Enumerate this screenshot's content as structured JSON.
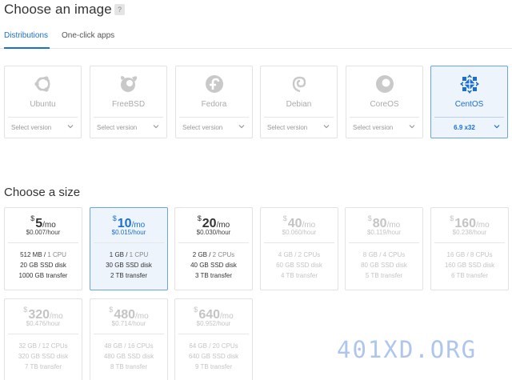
{
  "image_section": {
    "title": "Choose an image",
    "help": "?"
  },
  "tabs": [
    {
      "label": "Distributions",
      "active": true
    },
    {
      "label": "One-click apps",
      "active": false
    }
  ],
  "distributions": [
    {
      "name": "Ubuntu",
      "version": "Select version",
      "icon": "ubuntu-icon"
    },
    {
      "name": "FreeBSD",
      "version": "Select version",
      "icon": "freebsd-icon"
    },
    {
      "name": "Fedora",
      "version": "Select version",
      "icon": "fedora-icon"
    },
    {
      "name": "Debian",
      "version": "Select version",
      "icon": "debian-icon"
    },
    {
      "name": "CoreOS",
      "version": "Select version",
      "icon": "coreos-icon"
    },
    {
      "name": "CentOS",
      "version": "6.9 x32",
      "icon": "centos-icon",
      "selected": true
    }
  ],
  "size_section": {
    "title": "Choose a size"
  },
  "plans": [
    {
      "currency": "$",
      "amount": "5",
      "per": "/mo",
      "hourly": "$0.007/hour",
      "specs": [
        [
          "512 MB",
          "1 CPU"
        ],
        [
          "20 GB",
          "SSD disk"
        ],
        [
          "1000 GB",
          "transfer"
        ]
      ],
      "state": "normal"
    },
    {
      "currency": "$",
      "amount": "10",
      "per": "/mo",
      "hourly": "$0.015/hour",
      "specs": [
        [
          "1 GB",
          "1 CPU"
        ],
        [
          "30 GB",
          "SSD disk"
        ],
        [
          "2 TB",
          "transfer"
        ]
      ],
      "state": "selected"
    },
    {
      "currency": "$",
      "amount": "20",
      "per": "/mo",
      "hourly": "$0.030/hour",
      "specs": [
        [
          "2 GB",
          "2 CPUs"
        ],
        [
          "40 GB",
          "SSD disk"
        ],
        [
          "3 TB",
          "transfer"
        ]
      ],
      "state": "normal"
    },
    {
      "currency": "$",
      "amount": "40",
      "per": "/mo",
      "hourly": "$0.060/hour",
      "specs": [
        [
          "4 GB",
          "2 CPUs"
        ],
        [
          "60 GB",
          "SSD disk"
        ],
        [
          "4 TB",
          "transfer"
        ]
      ],
      "state": "disabled"
    },
    {
      "currency": "$",
      "amount": "80",
      "per": "/mo",
      "hourly": "$0.119/hour",
      "specs": [
        [
          "8 GB",
          "4 CPUs"
        ],
        [
          "80 GB",
          "SSD disk"
        ],
        [
          "5 TB",
          "transfer"
        ]
      ],
      "state": "disabled"
    },
    {
      "currency": "$",
      "amount": "160",
      "per": "/mo",
      "hourly": "$0.238/hour",
      "specs": [
        [
          "16 GB",
          "8 CPUs"
        ],
        [
          "160 GB",
          "SSD disk"
        ],
        [
          "6 TB",
          "transfer"
        ]
      ],
      "state": "disabled"
    },
    {
      "currency": "$",
      "amount": "320",
      "per": "/mo",
      "hourly": "$0.476/hour",
      "specs": [
        [
          "32 GB",
          "12 CPUs"
        ],
        [
          "320 GB",
          "SSD disk"
        ],
        [
          "7 TB",
          "transfer"
        ]
      ],
      "state": "disabled"
    },
    {
      "currency": "$",
      "amount": "480",
      "per": "/mo",
      "hourly": "$0.714/hour",
      "specs": [
        [
          "48 GB",
          "16 CPUs"
        ],
        [
          "480 GB",
          "SSD disk"
        ],
        [
          "8 TB",
          "transfer"
        ]
      ],
      "state": "disabled"
    },
    {
      "currency": "$",
      "amount": "640",
      "per": "/mo",
      "hourly": "$0.952/hour",
      "specs": [
        [
          "64 GB",
          "20 CPUs"
        ],
        [
          "640 GB",
          "SSD disk"
        ],
        [
          "9 TB",
          "transfer"
        ]
      ],
      "state": "disabled"
    }
  ],
  "watermark": "401XD.ORG",
  "colors": {
    "accent": "#1a6fd1",
    "selected_bg": "#eef4fc",
    "selected_border": "#6aa3e6",
    "disabled_text": "#c4c4c4"
  }
}
